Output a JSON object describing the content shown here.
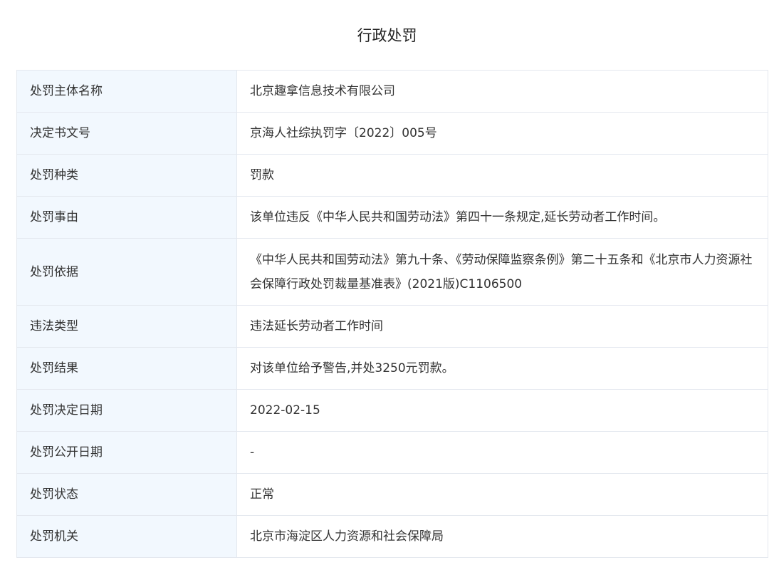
{
  "page": {
    "title": "行政处罚"
  },
  "rows": [
    {
      "label": "处罚主体名称",
      "value": "北京趣拿信息技术有限公司"
    },
    {
      "label": "决定书文号",
      "value": "京海人社综执罚字〔2022〕005号"
    },
    {
      "label": "处罚种类",
      "value": "罚款"
    },
    {
      "label": "处罚事由",
      "value": "该单位违反《中华人民共和国劳动法》第四十一条规定,延长劳动者工作时间。"
    },
    {
      "label": "处罚依据",
      "value": "《中华人民共和国劳动法》第九十条、《劳动保障监察条例》第二十五条和《北京市人力资源社会保障行政处罚裁量基准表》(2021版)C1106500"
    },
    {
      "label": "违法类型",
      "value": "违法延长劳动者工作时间"
    },
    {
      "label": "处罚结果",
      "value": "对该单位给予警告,并处3250元罚款。"
    },
    {
      "label": "处罚决定日期",
      "value": "2022-02-15"
    },
    {
      "label": "处罚公开日期",
      "value": "-"
    },
    {
      "label": "处罚状态",
      "value": "正常"
    },
    {
      "label": "处罚机关",
      "value": "北京市海淀区人力资源和社会保障局"
    }
  ]
}
